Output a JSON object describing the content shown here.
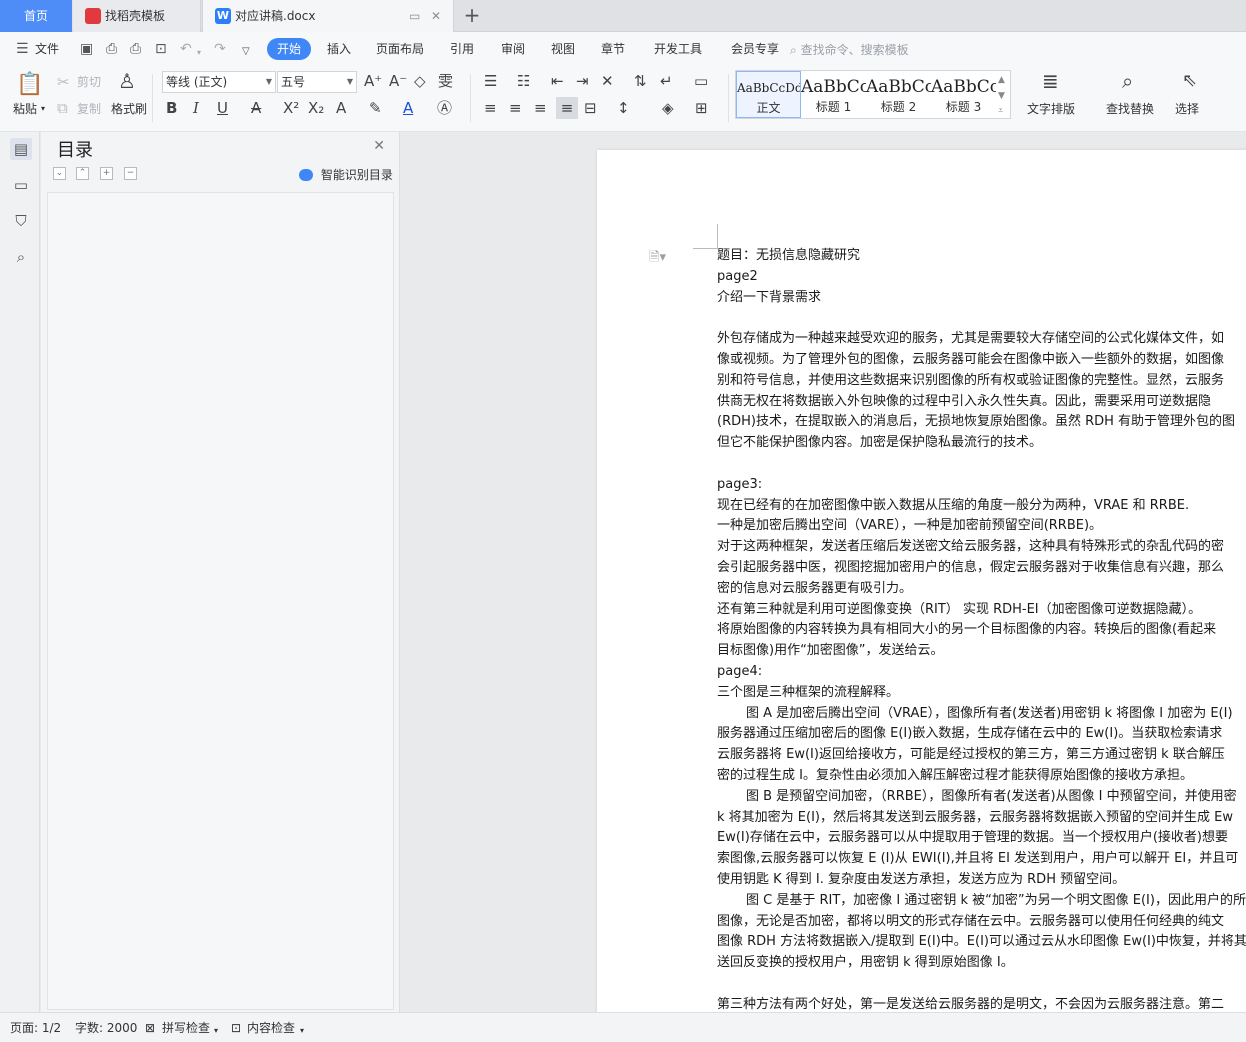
{
  "tabs": {
    "home": "首页",
    "template": "找稻壳模板",
    "doc": "对应讲稿.docx",
    "new_tab": "+"
  },
  "menu": {
    "file": "文件",
    "items": [
      "开始",
      "插入",
      "页面布局",
      "引用",
      "审阅",
      "视图",
      "章节",
      "开发工具",
      "会员专享"
    ],
    "search": "查找命令、搜索模板"
  },
  "ribbon": {
    "paste": "粘贴",
    "cut": "剪切",
    "copy": "复制",
    "format_painter": "格式刷",
    "font_name": "等线 (正文)",
    "font_size": "五号",
    "styles": [
      {
        "preview": "AaBbCcDd",
        "name": "正文"
      },
      {
        "preview": "AaBbCc",
        "name": "标题 1"
      },
      {
        "preview": "AaBbCc",
        "name": "标题 2"
      },
      {
        "preview": "AaBbCcI",
        "name": "标题 3"
      }
    ],
    "text_layout": "文字排版",
    "find_replace": "查找替换",
    "select": "选择"
  },
  "toc": {
    "title": "目录",
    "smart": "智能识别目录"
  },
  "document": {
    "lines": [
      {
        "t": "题目：无损信息隐藏研究",
        "k": ""
      },
      {
        "t": "page2",
        "k": ""
      },
      {
        "t": "介绍一下背景需求",
        "k": ""
      },
      {
        "t": "",
        "k": "blank"
      },
      {
        "t": "外包存储成为一种越来越受欢迎的服务，尤其是需要较大存储空间的公式化媒体文件，如",
        "k": ""
      },
      {
        "t": "像或视频。为了管理外包的图像，云服务器可能会在图像中嵌入一些额外的数据，如图像",
        "k": ""
      },
      {
        "t": "别和符号信息，并使用这些数据来识别图像的所有权或验证图像的完整性。显然，云服务",
        "k": ""
      },
      {
        "t": "供商无权在将数据嵌入外包映像的过程中引入永久性失真。因此，需要采用可逆数据隐",
        "k": ""
      },
      {
        "t": "(RDH)技术，在提取嵌入的消息后，无损地恢复原始图像。虽然 RDH 有助于管理外包的图",
        "k": ""
      },
      {
        "t": "但它不能保护图像内容。加密是保护隐私最流行的技术。",
        "k": ""
      },
      {
        "t": "",
        "k": "blank"
      },
      {
        "t": "page3:",
        "k": ""
      },
      {
        "t": "现在已经有的在加密图像中嵌入数据从压缩的角度一般分为两种，VRAE 和 RRBE.",
        "k": ""
      },
      {
        "t": "一种是加密后腾出空间（VARE），一种是加密前预留空间(RRBE)。",
        "k": ""
      },
      {
        "t": "对于这两种框架，发送者压缩后发送密文给云服务器，这种具有特殊形式的杂乱代码的密",
        "k": ""
      },
      {
        "t": "会引起服务器中医，视图挖掘加密用户的信息，假定云服务器对于收集信息有兴趣，那么",
        "k": ""
      },
      {
        "t": "密的信息对云服务器更有吸引力。",
        "k": ""
      },
      {
        "t": "还有第三种就是利用可逆图像变换（RIT） 实现 RDH-EI（加密图像可逆数据隐藏）。",
        "k": ""
      },
      {
        "t": "将原始图像的内容转换为具有相同大小的另一个目标图像的内容。转换后的图像(看起来",
        "k": ""
      },
      {
        "t": "目标图像)用作“加密图像”，发送给云。",
        "k": ""
      },
      {
        "t": "page4:",
        "k": ""
      },
      {
        "t": "三个图是三种框架的流程解释。",
        "k": ""
      },
      {
        "t": "图 A 是加密后腾出空间（VRAE），图像所有者(发送者)用密钥 k 将图像 I 加密为 E(I)",
        "k": "ind"
      },
      {
        "t": "服务器通过压缩加密后的图像 E(I)嵌入数据，生成存储在云中的 Ew(I)。当获取检索请求",
        "k": ""
      },
      {
        "t": "云服务器将 Ew(I)返回给接收方，可能是经过授权的第三方，第三方通过密钥 k 联合解压",
        "k": ""
      },
      {
        "t": "密的过程生成 I。复杂性由必须加入解压解密过程才能获得原始图像的接收方承担。",
        "k": ""
      },
      {
        "t": "图 B 是预留空间加密，（RRBE），图像所有者(发送者)从图像 I 中预留空间，并使用密",
        "k": "ind"
      },
      {
        "t": "k 将其加密为 E(I)，然后将其发送到云服务器，云服务器将数据嵌入预留的空间并生成 Ew",
        "k": ""
      },
      {
        "t": "Ew(I)存储在云中，云服务器可以从中提取用于管理的数据。当一个授权用户(接收者)想要",
        "k": ""
      },
      {
        "t": "索图像,云服务器可以恢复 E (I)从 EWI(I),并且将 EI 发送到用户，用户可以解开 EI，并且可",
        "k": ""
      },
      {
        "t": "使用钥匙 K 得到 I. 复杂度由发送方承担，发送方应为 RDH 预留空间。",
        "k": ""
      },
      {
        "t": "图 C 是基于 RIT，加密像 I 通过密钥 k 被“加密”为另一个明文图像 E(I)，因此用户的所",
        "k": "ind"
      },
      {
        "t": "图像，无论是否加密，都将以明文的形式存储在云中。云服务器可以使用任何经典的纯文",
        "k": ""
      },
      {
        "t": "图像 RDH 方法将数据嵌入/提取到 E(I)中。E(I)可以通过云从水印图像 Ew(I)中恢复，并将其",
        "k": ""
      },
      {
        "t": "送回反变换的授权用户，用密钥 k 得到原始图像 I。",
        "k": ""
      },
      {
        "t": "",
        "k": "blank"
      },
      {
        "t": "第三种方法有两个好处，第一是发送给云服务器的是明文，不会因为云服务器注意。第二",
        "k": ""
      }
    ]
  },
  "status": {
    "page": "页面: 1/2",
    "words": "字数: 2000",
    "spell": "拼写检查",
    "content": "内容检查"
  }
}
